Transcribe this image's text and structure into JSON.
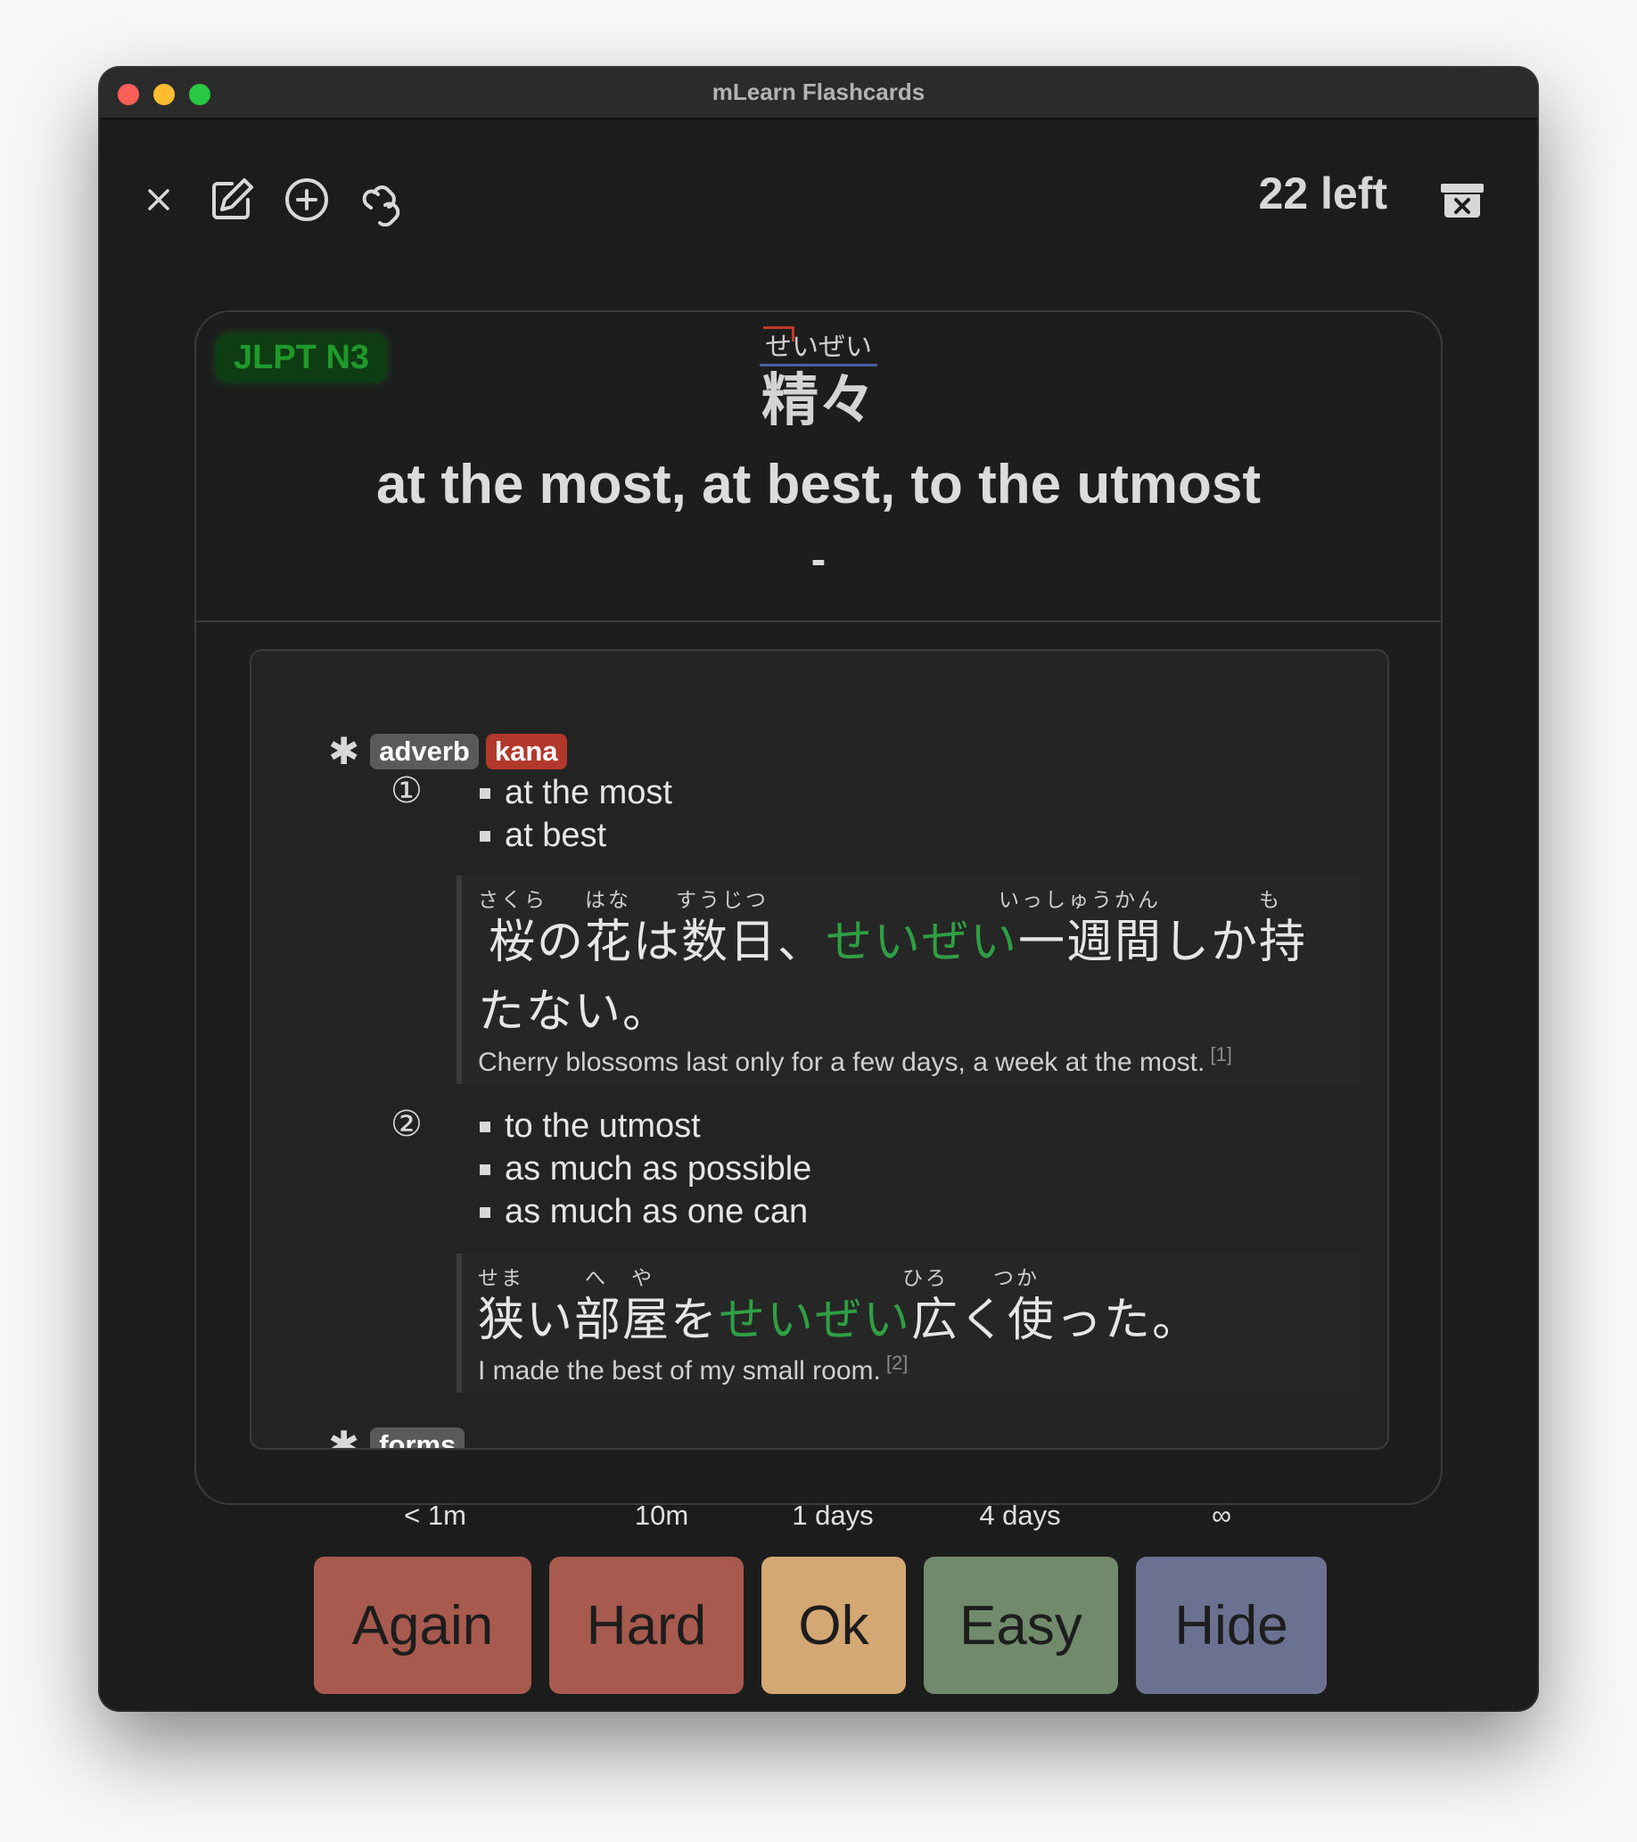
{
  "window": {
    "title": "mLearn Flashcards"
  },
  "toolbar": {
    "close_icon": "close-icon",
    "edit_icon": "edit-icon",
    "add_icon": "add-circle-icon",
    "link_icon": "link-icon",
    "cards_left": "22 left",
    "archive_icon": "archive-icon"
  },
  "card": {
    "jlpt_badge": "JLPT N3",
    "reading": "せいぜい",
    "word": "精々",
    "meaning": "at the most, at best, to the utmost",
    "dash": "-",
    "pos_tags": [
      "adverb",
      "kana"
    ],
    "senses": [
      {
        "number": "①",
        "glosses": [
          "at the most",
          "at best"
        ],
        "example": {
          "line1_furigana": [
            "さくら",
            "はな",
            "すうじつ",
            "いっしゅうかん",
            "も"
          ],
          "line1_prefix": "桜の花は数日、",
          "line1_highlight": "せいぜい",
          "line1_suffix": "一週間しか持",
          "line2": "たない。",
          "translation": "Cherry blossoms last only for a few days, a week at the most.",
          "ref": "[1]"
        }
      },
      {
        "number": "②",
        "glosses": [
          "to the utmost",
          "as much as possible",
          "as much as one can"
        ],
        "example": {
          "line1_furigana": [
            "せま",
            "へ",
            "や",
            "ひろ",
            "つか"
          ],
          "line1_prefix": "狭い部屋を",
          "line1_highlight": "せいぜい",
          "line1_suffix": "広く使った。",
          "translation": "I made the best of my small room.",
          "ref": "[2]"
        }
      }
    ],
    "forms_tag": "forms"
  },
  "answers": [
    {
      "label": "Again",
      "interval": "< 1m",
      "color": "#a85a4f"
    },
    {
      "label": "Hard",
      "interval": "10m",
      "color": "#a85a4f"
    },
    {
      "label": "Ok",
      "interval": "1 days",
      "color": "#d3a872"
    },
    {
      "label": "Easy",
      "interval": "4 days",
      "color": "#718a6c"
    },
    {
      "label": "Hide",
      "interval": "∞",
      "color": "#6b7191"
    }
  ],
  "colors": {
    "accent_green": "#2ea043",
    "kana_tag": "#b2382c"
  }
}
